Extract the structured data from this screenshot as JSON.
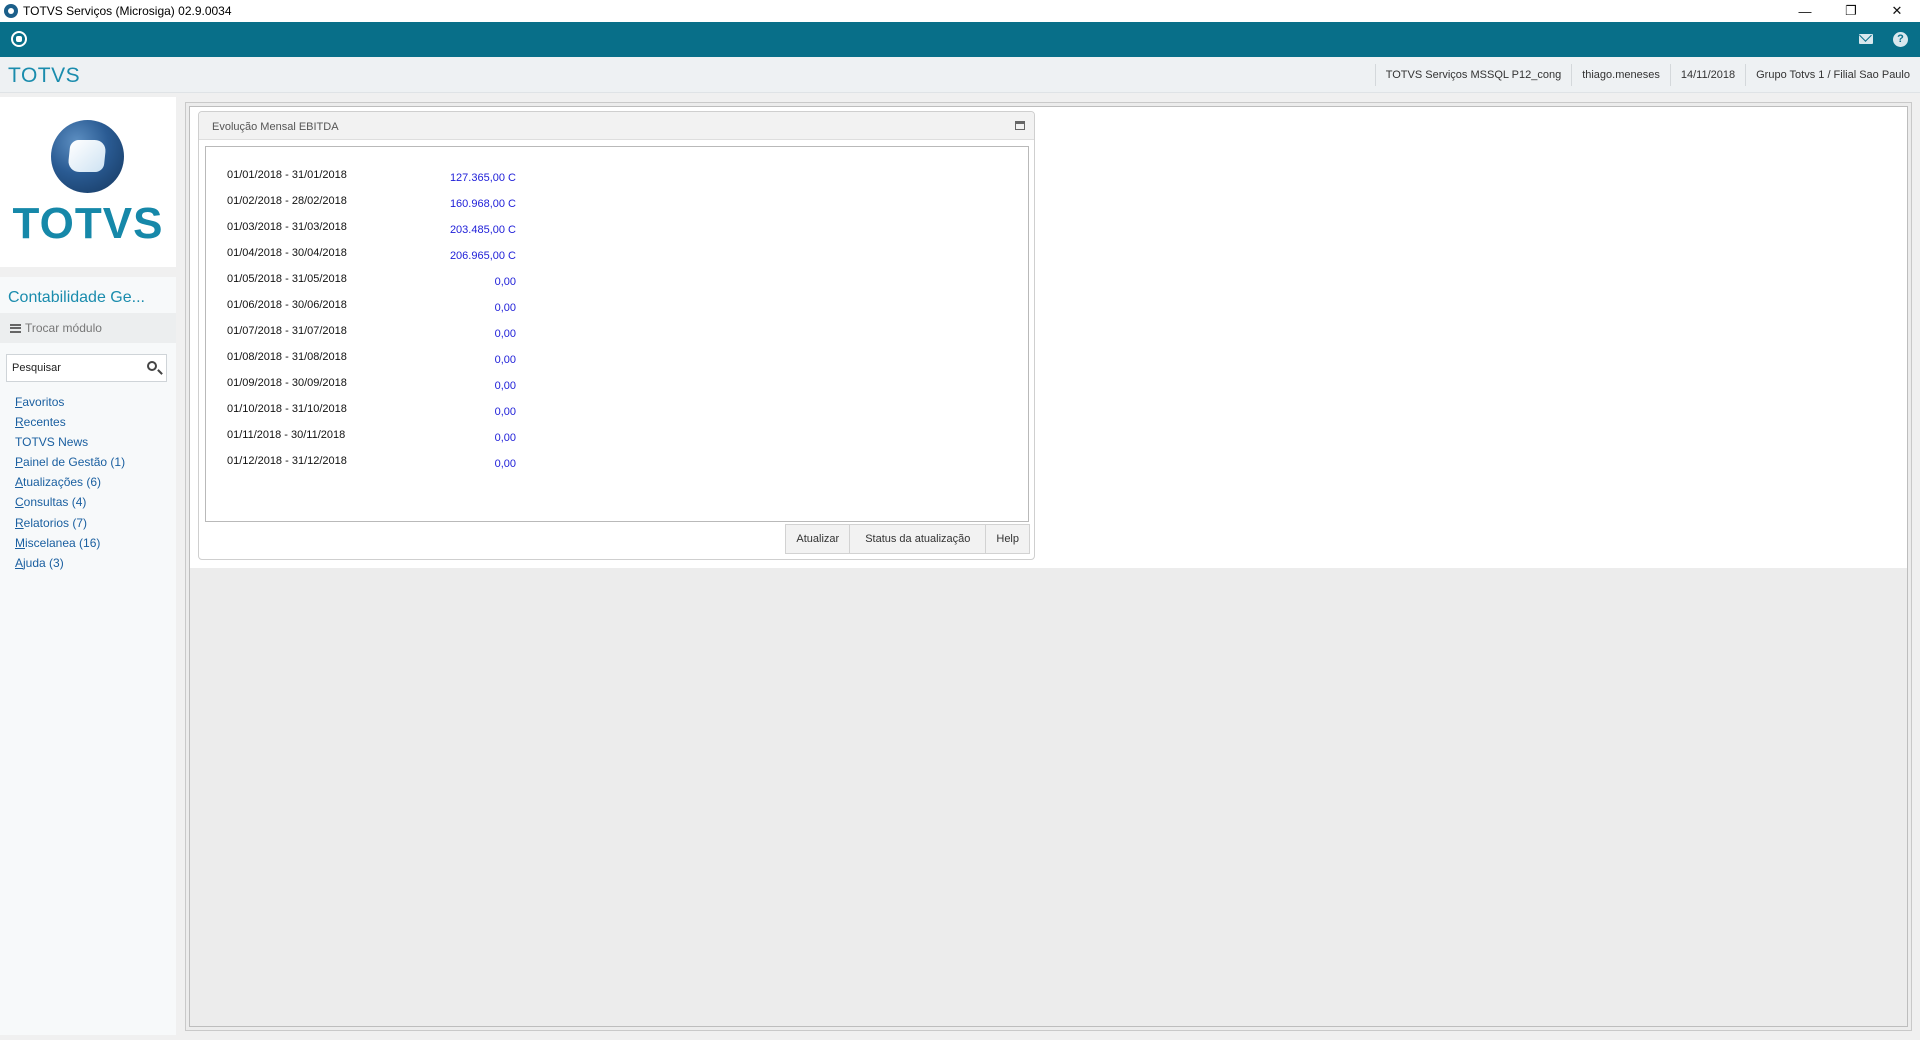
{
  "window": {
    "title": "TOTVS Serviços (Microsiga) 02.9.0034",
    "minimize_glyph": "—",
    "restore_glyph": "❐",
    "close_glyph": "✕"
  },
  "topbar": {
    "help_glyph": "?"
  },
  "header": {
    "brand": "TOTVS",
    "environment": "TOTVS Serviços MSSQL P12_cong",
    "user": "thiago.meneses",
    "date": "14/11/2018",
    "company": "Grupo Totvs 1 / Filial Sao Paulo"
  },
  "sidebar": {
    "logo_text": "TOTVS",
    "module_title": "Contabilidade Ge...",
    "switch_module_label": "Trocar módulo",
    "search_placeholder": "Pesquisar",
    "menu": [
      {
        "first": "F",
        "rest": "avoritos"
      },
      {
        "first": "R",
        "rest": "ecentes"
      },
      {
        "first": "",
        "rest": "TOTVS News"
      },
      {
        "first": "P",
        "rest": "ainel de Gestão (1)"
      },
      {
        "first": "A",
        "rest": "tualizações (6)"
      },
      {
        "first": "C",
        "rest": "onsultas (4)"
      },
      {
        "first": "R",
        "rest": "elatorios (7)"
      },
      {
        "first": "M",
        "rest": "iscelanea (16)"
      },
      {
        "first": "A",
        "rest": "juda (3)"
      }
    ]
  },
  "panel": {
    "title": "Evolução Mensal EBITDA",
    "rows": [
      {
        "period": "01/01/2018 - 31/01/2018",
        "amount": "127.365,00 C"
      },
      {
        "period": "01/02/2018 - 28/02/2018",
        "amount": "160.968,00 C"
      },
      {
        "period": "01/03/2018 - 31/03/2018",
        "amount": "203.485,00 C"
      },
      {
        "period": "01/04/2018 - 30/04/2018",
        "amount": "206.965,00 C"
      },
      {
        "period": "01/05/2018 - 31/05/2018",
        "amount": "0,00"
      },
      {
        "period": "01/06/2018 - 30/06/2018",
        "amount": "0,00"
      },
      {
        "period": "01/07/2018 - 31/07/2018",
        "amount": "0,00"
      },
      {
        "period": "01/08/2018 - 31/08/2018",
        "amount": "0,00"
      },
      {
        "period": "01/09/2018 - 30/09/2018",
        "amount": "0,00"
      },
      {
        "period": "01/10/2018 - 31/10/2018",
        "amount": "0,00"
      },
      {
        "period": "01/11/2018 - 30/11/2018",
        "amount": "0,00"
      },
      {
        "period": "01/12/2018 - 31/12/2018",
        "amount": "0,00"
      }
    ],
    "buttons": {
      "refresh": "Atualizar",
      "status": "Status da atualização",
      "help": "Help"
    }
  },
  "colors": {
    "toolbar": "#086f89",
    "brand": "#1a8cad",
    "amount": "#1d1dd8",
    "link": "#1a5fa0"
  }
}
